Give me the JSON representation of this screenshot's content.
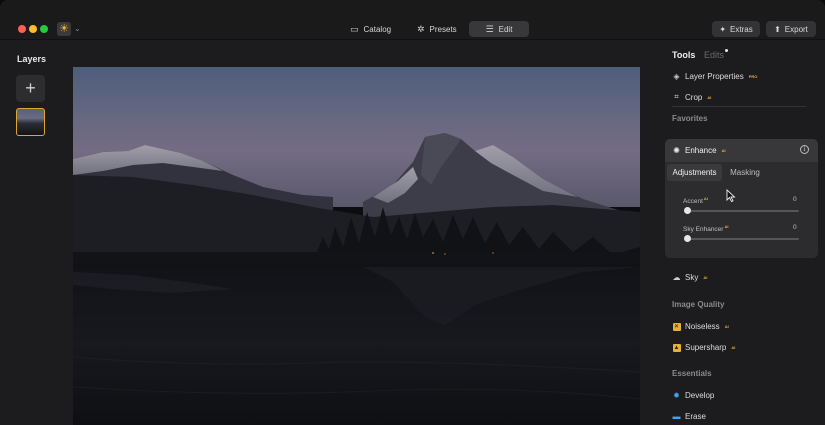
{
  "titlebar": {
    "nav": [
      {
        "label": "Catalog",
        "icon": "catalog-icon"
      },
      {
        "label": "Presets",
        "icon": "presets-icon"
      },
      {
        "label": "Edit",
        "icon": "sliders-icon",
        "active": true
      }
    ],
    "extras_label": "Extras",
    "export_label": "Export"
  },
  "layers": {
    "title": "Layers",
    "add_glyph": "+"
  },
  "panel": {
    "tabs": {
      "tools": "Tools",
      "edits": "Edits"
    },
    "layer_properties": {
      "label": "Layer Properties",
      "badge": "PRO"
    },
    "crop": {
      "label": "Crop",
      "badge": "AI"
    },
    "favorites": "Favorites",
    "enhance": {
      "label": "Enhance",
      "badge": "AI",
      "subtabs": [
        "Adjustments",
        "Masking"
      ],
      "sliders": [
        {
          "label": "Accent",
          "badge": "AI",
          "value": 0
        },
        {
          "label": "Sky Enhancer",
          "badge": "AI",
          "value": 0
        }
      ]
    },
    "sky": {
      "label": "Sky",
      "badge": "AI"
    },
    "image_quality": "Image Quality",
    "noiseless": {
      "label": "Noiseless",
      "badge": "AI"
    },
    "supersharp": {
      "label": "Supersharp",
      "badge": "AI"
    },
    "essentials": "Essentials",
    "develop": {
      "label": "Develop"
    },
    "erase": {
      "label": "Erase"
    }
  },
  "colors": {
    "accent": "#e0a52e",
    "badge": "#e6b034",
    "background": "#1c1c1e"
  }
}
